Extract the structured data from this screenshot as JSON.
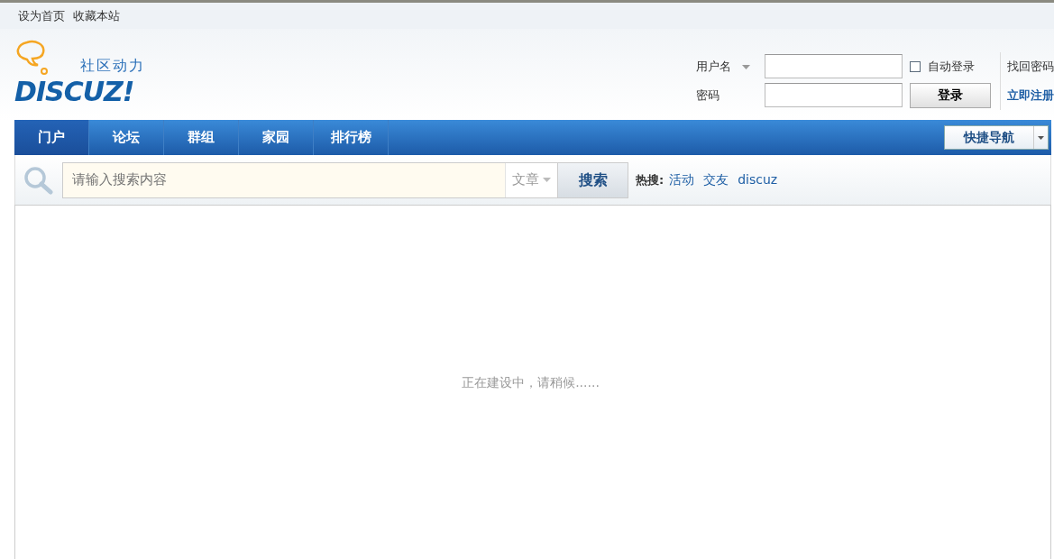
{
  "topbar": {
    "links": [
      "设为首页",
      "收藏本站"
    ]
  },
  "logo": {
    "tagline": "社区动力",
    "wordmark": "DISCUZ!"
  },
  "login": {
    "username_label": "用户名",
    "password_label": "密码",
    "remember": {
      "label": "自动登录",
      "checked": false
    },
    "submit": "登录",
    "forgot": "找回密码",
    "register": "立即注册"
  },
  "nav": {
    "items": [
      {
        "label": "门户",
        "selected": true
      },
      {
        "label": "论坛",
        "selected": false
      },
      {
        "label": "群组",
        "selected": false
      },
      {
        "label": "家园",
        "selected": false
      },
      {
        "label": "排行榜",
        "selected": false
      }
    ],
    "quick_nav": "快捷导航"
  },
  "search": {
    "placeholder": "请输入搜索内容",
    "type": "文章",
    "button": "搜索",
    "hot_label": "热搜:",
    "hot": [
      "活动",
      "交友",
      "discuz"
    ]
  },
  "content": {
    "message": "正在建设中，请稍候......"
  }
}
